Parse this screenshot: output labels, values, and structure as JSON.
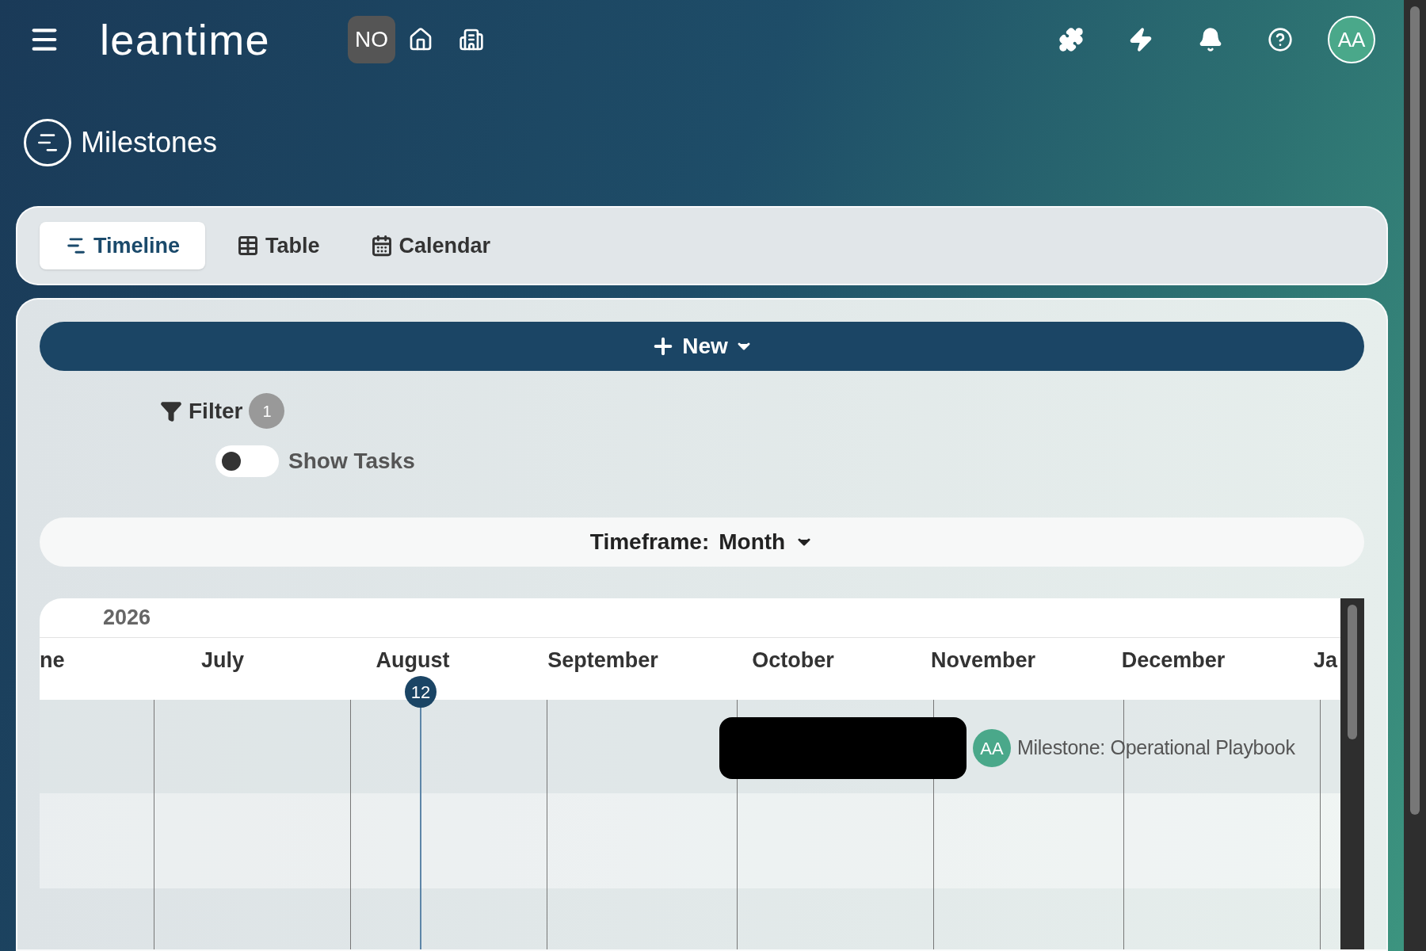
{
  "header": {
    "logo": "leantime",
    "project_badge": "NO",
    "avatar": "AA"
  },
  "page_title": "Milestones",
  "tabs": [
    {
      "label": "Timeline",
      "kind": "timeline",
      "selected": true
    },
    {
      "label": "Table",
      "kind": "table",
      "selected": false
    },
    {
      "label": "Calendar",
      "kind": "calendar",
      "selected": false
    }
  ],
  "new_button": "New",
  "filter": {
    "label": "Filter",
    "count": "1"
  },
  "show_tasks": {
    "label": "Show Tasks",
    "on": false
  },
  "timeframe": {
    "label": "Timeframe:",
    "value": "Month"
  },
  "timeline": {
    "year": "2026",
    "months": [
      "ne",
      "July",
      "August",
      "September",
      "October",
      "November",
      "December",
      "Ja"
    ],
    "today": "12",
    "milestones": [
      {
        "owner": "AA",
        "title": "Milestone: Operational Playbook"
      }
    ]
  }
}
